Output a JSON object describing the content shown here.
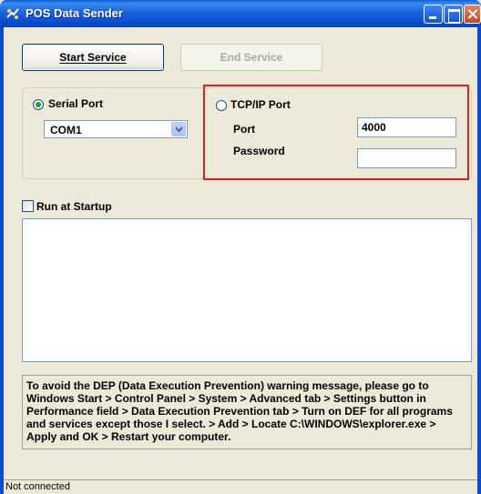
{
  "window": {
    "title": "POS Data Sender"
  },
  "toolbar": {
    "start_label": "Start Service",
    "end_label": "End Service"
  },
  "serial": {
    "label": "Serial Port",
    "selected": true,
    "port_value": "COM1"
  },
  "tcp": {
    "label": "TCP/IP Port",
    "selected": false,
    "port_label": "Port",
    "port_value": "4000",
    "password_label": "Password",
    "password_value": ""
  },
  "startup": {
    "label": "Run at Startup",
    "checked": false
  },
  "log": {
    "content": ""
  },
  "info": {
    "message": "To avoid the DEP (Data Execution Prevention) warning message, please go to Windows Start > Control Panel > System > Advanced tab > Settings button in Performance field > Data Execution Prevention tab > Turn on DEF for all programs and services except those I select. > Add > Locate C:\\WINDOWS\\explorer.exe > Apply and OK > Restart your computer."
  },
  "status": {
    "text": "Not connected"
  },
  "colors": {
    "highlight_border": "#e02020",
    "titlebar": "#0a4dd0",
    "window_bg": "#ece9d8"
  }
}
